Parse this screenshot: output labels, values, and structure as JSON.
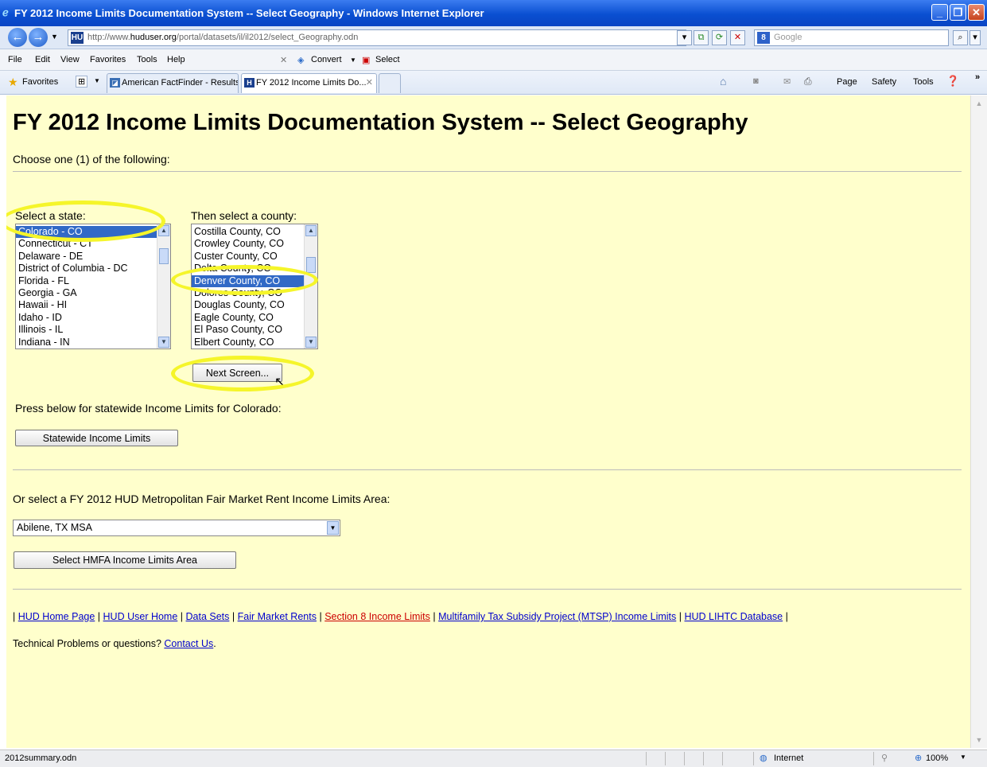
{
  "window": {
    "title": "FY 2012 Income Limits Documentation System -- Select Geography - Windows Internet Explorer"
  },
  "address_bar": {
    "url_prefix": "http://www.",
    "url_domain": "huduser.org",
    "url_path": "/portal/datasets/il/il2012/select_Geography.odn",
    "search_placeholder": "Google"
  },
  "menu": [
    "File",
    "Edit",
    "View",
    "Favorites",
    "Tools",
    "Help"
  ],
  "toolbar": {
    "convert_label": "Convert",
    "select_label": "Select"
  },
  "favorites_bar": {
    "favorites_label": "Favorites",
    "tabs": [
      {
        "label": "American FactFinder - Results"
      },
      {
        "label": "FY 2012 Income Limits Do..."
      }
    ],
    "commands": [
      "Page",
      "Safety",
      "Tools"
    ]
  },
  "page": {
    "title": "FY 2012 Income Limits Documentation System -- Select Geography",
    "intro": "Choose one (1) of the following:",
    "state_label": "Select a state:",
    "county_label": "Then select a county:",
    "states": [
      {
        "label": "Colorado - CO",
        "selected": true
      },
      {
        "label": "Connecticut - CT",
        "selected": false
      },
      {
        "label": "Delaware - DE",
        "selected": false
      },
      {
        "label": "District of Columbia - DC",
        "selected": false
      },
      {
        "label": "Florida - FL",
        "selected": false
      },
      {
        "label": "Georgia - GA",
        "selected": false
      },
      {
        "label": "Hawaii - HI",
        "selected": false
      },
      {
        "label": "Idaho - ID",
        "selected": false
      },
      {
        "label": "Illinois - IL",
        "selected": false
      },
      {
        "label": "Indiana - IN",
        "selected": false
      }
    ],
    "counties": [
      {
        "label": "Costilla County, CO",
        "selected": false
      },
      {
        "label": "Crowley County, CO",
        "selected": false
      },
      {
        "label": "Custer County, CO",
        "selected": false
      },
      {
        "label": "Delta County, CO",
        "selected": false
      },
      {
        "label": "Denver County, CO",
        "selected": true
      },
      {
        "label": "Dolores County, CO",
        "selected": false
      },
      {
        "label": "Douglas County, CO",
        "selected": false
      },
      {
        "label": "Eagle County, CO",
        "selected": false
      },
      {
        "label": "El Paso County, CO",
        "selected": false
      },
      {
        "label": "Elbert County, CO",
        "selected": false
      }
    ],
    "next_button": "Next Screen...",
    "statewide_text": "Press below for statewide Income Limits for Colorado:",
    "statewide_button": "Statewide Income Limits",
    "hmfa_text": "Or select a FY 2012 HUD Metropolitan Fair Market Rent Income Limits Area:",
    "hmfa_selected": "Abilene, TX MSA",
    "hmfa_button": "Select HMFA Income Limits Area",
    "footer_links": [
      {
        "label": "HUD Home Page",
        "visited": false
      },
      {
        "label": "HUD User Home",
        "visited": false
      },
      {
        "label": "Data Sets",
        "visited": false
      },
      {
        "label": "Fair Market Rents",
        "visited": false
      },
      {
        "label": "Section 8 Income Limits",
        "visited": true
      },
      {
        "label": "Multifamily Tax Subsidy Project (MTSP) Income Limits",
        "visited": false
      },
      {
        "label": "HUD LIHTC Database",
        "visited": false
      }
    ],
    "contact_prefix": "Technical Problems or questions?",
    "contact_link": "Contact Us"
  },
  "status_bar": {
    "status_text": "2012summary.odn",
    "zone": "Internet",
    "zoom": "100%"
  },
  "colors": {
    "page_background": "#ffffcc",
    "highlight_ellipse": "#f5f52a",
    "selection": "#3169c6",
    "visited_link": "#cc0000",
    "link": "#0000cc"
  }
}
